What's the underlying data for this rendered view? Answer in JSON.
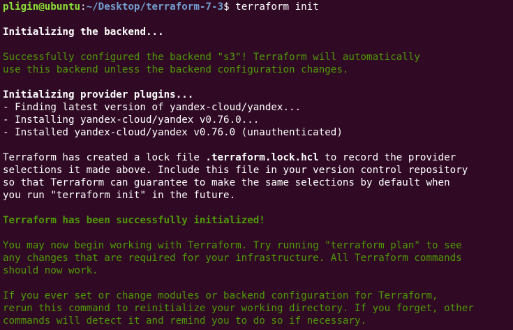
{
  "prompt": {
    "user_host": "pligin@ubuntu",
    "separator": ":",
    "path": "~/Desktop/terraform-7-3",
    "symbol": "$",
    "command": " terraform init"
  },
  "backend": {
    "heading": "Initializing the backend...",
    "line1": "Successfully configured the backend \"s3\"! Terraform will automatically",
    "line2": "use this backend unless the backend configuration changes."
  },
  "providers": {
    "heading": "Initializing provider plugins...",
    "items": [
      "- Finding latest version of yandex-cloud/yandex...",
      "- Installing yandex-cloud/yandex v0.76.0...",
      "- Installed yandex-cloud/yandex v0.76.0 (unauthenticated)"
    ]
  },
  "lockfile": {
    "line1_pre": "Terraform has created a lock file ",
    "line1_file": ".terraform.lock.hcl",
    "line1_post": " to record the provider",
    "line2": "selections it made above. Include this file in your version control repository",
    "line3": "so that Terraform can guarantee to make the same selections by default when",
    "line4": "you run \"terraform init\" in the future."
  },
  "success": {
    "heading": "Terraform has been successfully initialized!",
    "para1": [
      "You may now begin working with Terraform. Try running \"terraform plan\" to see",
      "any changes that are required for your infrastructure. All Terraform commands",
      "should now work."
    ],
    "para2": [
      "If you ever set or change modules or backend configuration for Terraform,",
      "rerun this command to reinitialize your working directory. If you forget, other",
      "commands will detect it and remind you to do so if necessary."
    ]
  },
  "colors": {
    "background": "#300a24",
    "green": "#4e9a06",
    "user": "#8ae234",
    "path": "#729fcf",
    "text": "#ffffff"
  }
}
